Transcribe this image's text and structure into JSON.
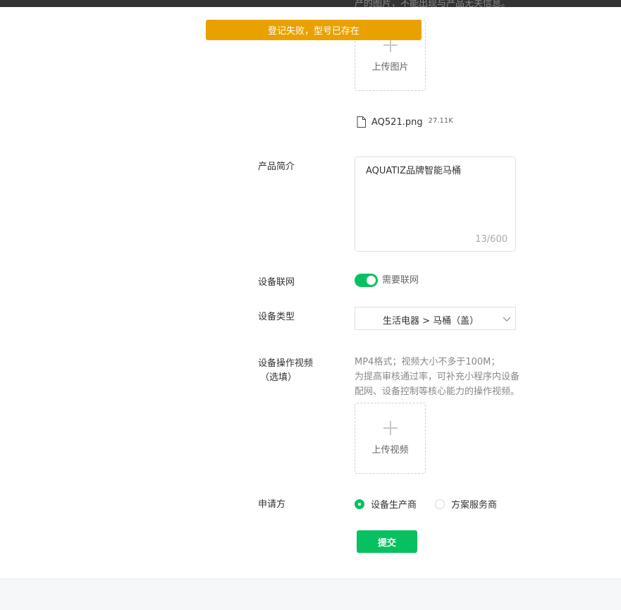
{
  "top_hint_partial": "产的图片，不能出现与产品无关信息。",
  "toast": {
    "message": "登记失败，型号已存在"
  },
  "image_upload": {
    "label": "上传图片",
    "file_name": "AQ521.png",
    "file_size": "27.11K"
  },
  "intro": {
    "label": "产品简介",
    "value": "AQUATIZ品牌智能马桶",
    "count": "13/600"
  },
  "network": {
    "label": "设备联网",
    "toggle_text": "需要联网",
    "enabled": true
  },
  "device_type": {
    "label": "设备类型",
    "value": "生活电器 > 马桶（盖）"
  },
  "video": {
    "label_line1": "设备操作视频",
    "label_line2": "（选填）",
    "hint_line1": "MP4格式；视频大小不多于100M；",
    "hint_line2": "为提高审核通过率，可补充小程序内设备",
    "hint_line3": "配网、设备控制等核心能力的操作视频。",
    "upload_label": "上传视频"
  },
  "applicant": {
    "label": "申请方",
    "options": [
      {
        "label": "设备生产商",
        "checked": true
      },
      {
        "label": "方案服务商",
        "checked": false
      }
    ]
  },
  "submit_label": "提交",
  "colors": {
    "accent": "#07c160",
    "toast": "#e9a100"
  }
}
